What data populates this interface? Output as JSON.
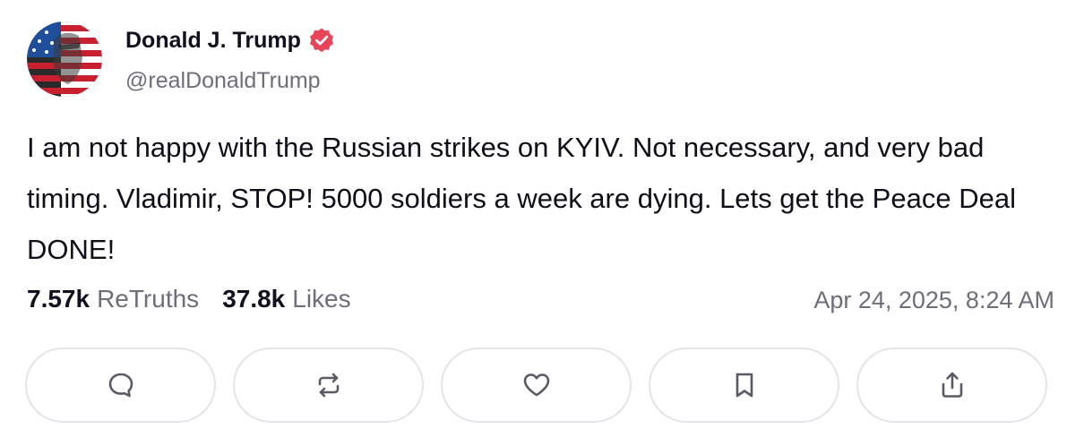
{
  "author": {
    "display_name": "Donald J. Trump",
    "handle": "@realDonaldTrump",
    "avatar_icon": "flag-portrait-avatar",
    "verified_icon": "verified-badge-icon",
    "verified_color": "#e8445a"
  },
  "post": {
    "text": "I am not happy with the Russian strikes on KYIV. Not necessary, and very bad timing. Vladimir, STOP! 5000 soldiers a week are dying. Lets get the Peace Deal DONE!"
  },
  "stats": {
    "retruths_count": "7.57k",
    "retruths_label": "ReTruths",
    "likes_count": "37.8k",
    "likes_label": "Likes"
  },
  "timestamp": "Apr 24, 2025, 8:24 AM",
  "actions": [
    {
      "icon": "reply-icon"
    },
    {
      "icon": "retruth-icon"
    },
    {
      "icon": "heart-icon"
    },
    {
      "icon": "bookmark-icon"
    },
    {
      "icon": "share-icon"
    }
  ],
  "colors": {
    "text": "#0f0f1a",
    "muted": "#6e6e7a",
    "border": "#e4e4ea",
    "icon": "#5a5a66"
  }
}
